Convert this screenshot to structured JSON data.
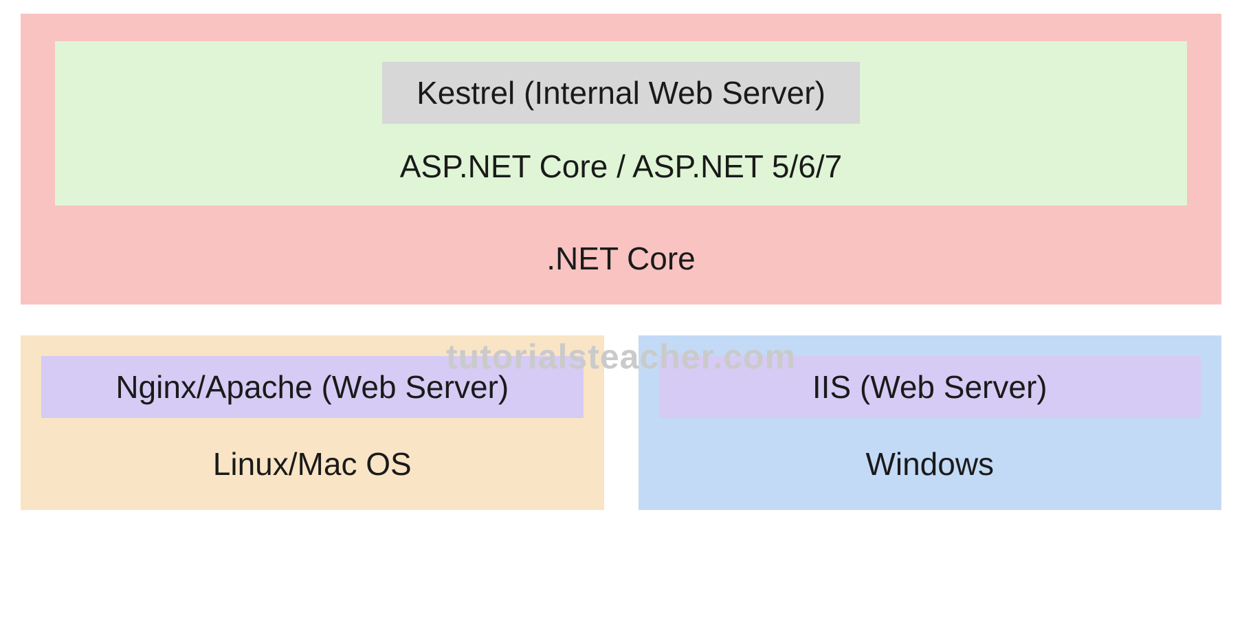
{
  "top": {
    "kestrel_label": "Kestrel (Internal Web Server)",
    "aspnet_label": "ASP.NET Core / ASP.NET 5/6/7",
    "netcore_label": ".NET Core"
  },
  "watermark": "tutorialsteacher.com",
  "bottom": {
    "linux": {
      "webserver_label": "Nginx/Apache (Web Server)",
      "os_label": "Linux/Mac OS"
    },
    "windows": {
      "webserver_label": "IIS (Web Server)",
      "os_label": "Windows"
    }
  },
  "colors": {
    "pink": "#f8c3c1",
    "green": "#dff5d6",
    "gray": "#d7d7d7",
    "cream": "#f9e4c5",
    "blue": "#c2daf5",
    "purple": "#d5cbf4",
    "watermark_gray": "#cacaca"
  }
}
